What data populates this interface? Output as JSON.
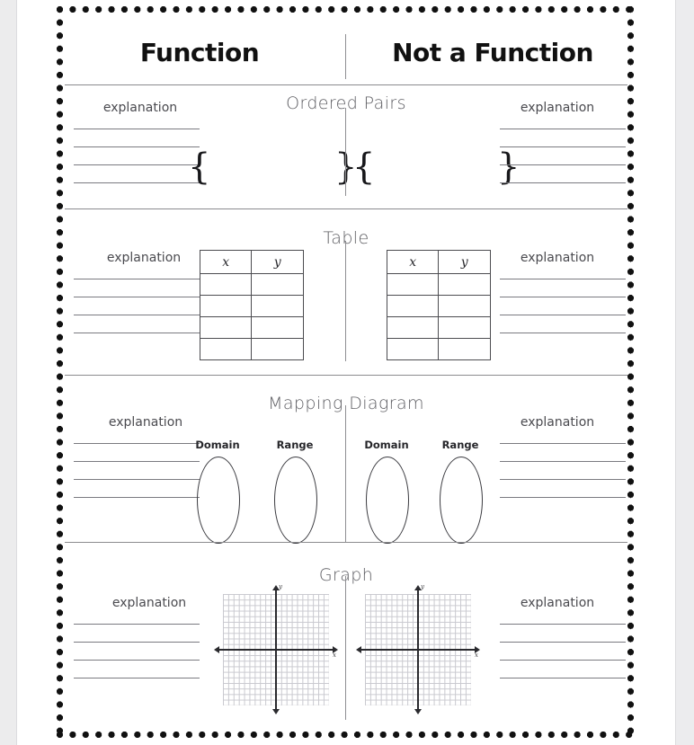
{
  "worksheet": {
    "header": {
      "left_title": "Function",
      "right_title": "Not a Function",
      "divider": "vertical-rule"
    },
    "explanation_label": "explanation",
    "explanation_line_count": 4,
    "sections": [
      {
        "id": "ordered-pairs",
        "title": "Ordered Pairs",
        "left": {
          "explanation": "explanation",
          "brace_open": "{",
          "brace_close": "}"
        },
        "right": {
          "explanation": "explanation",
          "brace_open": "{",
          "brace_close": "}"
        }
      },
      {
        "id": "table",
        "title": "Table",
        "left": {
          "explanation": "explanation",
          "table": {
            "headers": [
              "x",
              "y"
            ],
            "empty_row_count": 4
          }
        },
        "right": {
          "explanation": "explanation",
          "table": {
            "headers": [
              "x",
              "y"
            ],
            "empty_row_count": 4
          }
        }
      },
      {
        "id": "mapping-diagram",
        "title": "Mapping Diagram",
        "left": {
          "explanation": "explanation",
          "domain_label": "Domain",
          "range_label": "Range"
        },
        "right": {
          "explanation": "explanation",
          "domain_label": "Domain",
          "range_label": "Range"
        }
      },
      {
        "id": "graph",
        "title": "Graph",
        "left": {
          "explanation": "explanation",
          "graph": {
            "x_axis_label": "x",
            "y_axis_label": "y",
            "grid": "coordinate-plane"
          }
        },
        "right": {
          "explanation": "explanation",
          "graph": {
            "x_axis_label": "x",
            "y_axis_label": "y",
            "grid": "coordinate-plane"
          }
        }
      }
    ],
    "colors": {
      "ink": "#111111",
      "title_gray": "#5d5d62",
      "rule_gray": "#8b8b8e",
      "writing_line": "#7a7a80",
      "grid_line": "#c9c9cf",
      "page_edge": "#ececed"
    }
  }
}
